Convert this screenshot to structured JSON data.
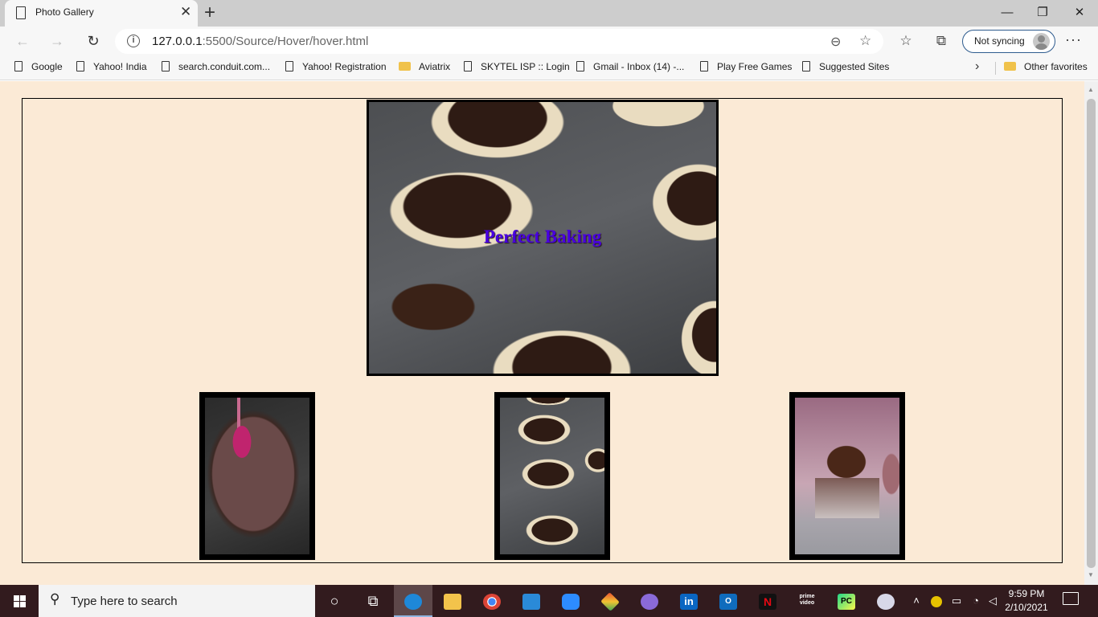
{
  "browser": {
    "tab_title": "Photo Gallery",
    "url_host": "127.0.0.1",
    "url_path": ":5500/Source/Hover/hover.html",
    "sync_label": "Not syncing"
  },
  "favorites": [
    {
      "label": "Google",
      "icon": "page-icon"
    },
    {
      "label": "Yahoo! India",
      "icon": "page-icon"
    },
    {
      "label": "search.conduit.com...",
      "icon": "page-icon"
    },
    {
      "label": "Yahoo! Registration",
      "icon": "page-icon"
    },
    {
      "label": "Aviatrix",
      "icon": "folder-icon"
    },
    {
      "label": "SKYTEL ISP :: Login",
      "icon": "page-icon"
    },
    {
      "label": "Gmail - Inbox (14) -...",
      "icon": "page-icon"
    },
    {
      "label": "Play Free Games",
      "icon": "page-icon"
    },
    {
      "label": "Suggested Sites",
      "icon": "page-icon"
    }
  ],
  "other_favorites": "Other favorites",
  "page": {
    "main_caption": "Perfect Baking",
    "background_color": "#fbead6",
    "caption_color": "#4800e0"
  },
  "taskbar": {
    "search_placeholder": "Type here to search",
    "time": "9:59 PM",
    "date": "2/10/2021"
  }
}
